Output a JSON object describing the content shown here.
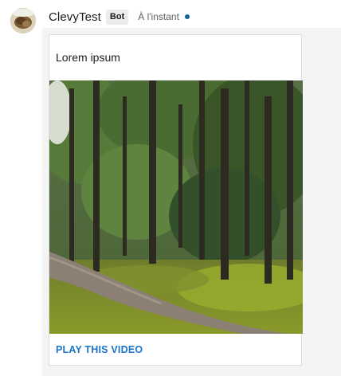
{
  "message": {
    "sender": "ClevyTest",
    "badge": "Bot",
    "timestamp": "À l'instant",
    "status_color": "#1264a3",
    "avatar_icon": "bot-avatar-image"
  },
  "card": {
    "text": "Lorem ipsum",
    "image_icon": "forest-path-photo",
    "link_label": "PLAY THIS VIDEO",
    "link_color": "#1a74c9"
  }
}
